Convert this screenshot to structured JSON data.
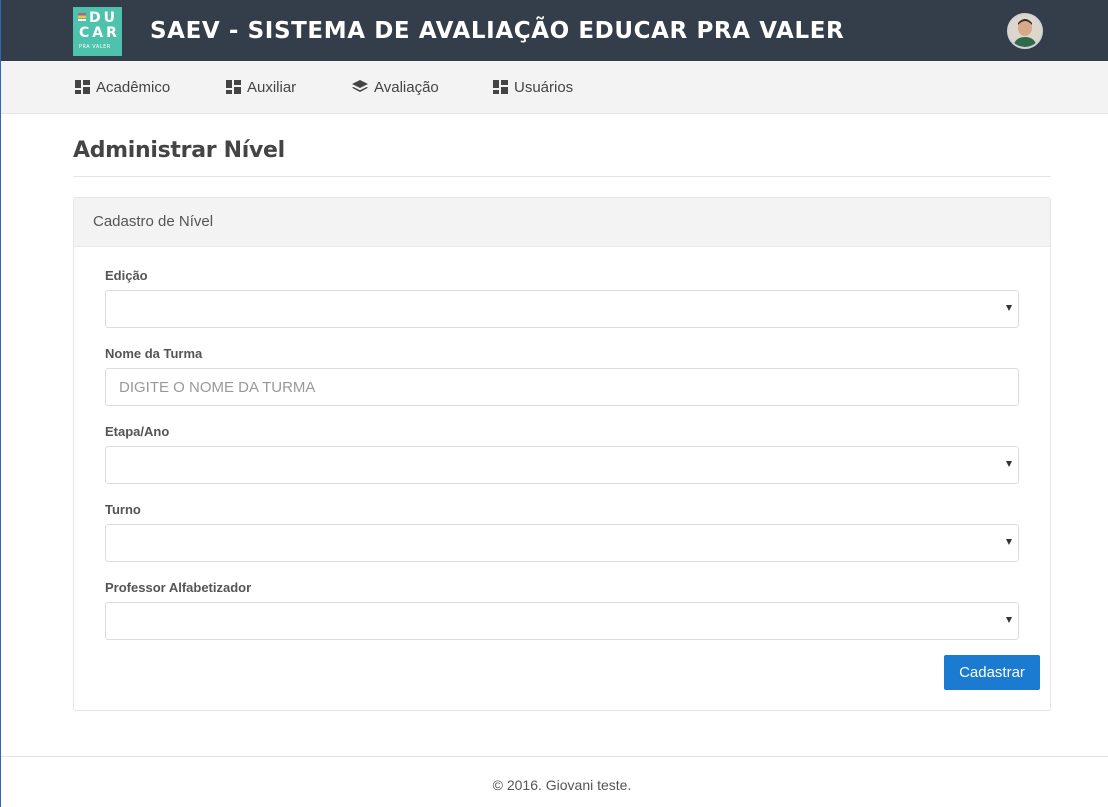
{
  "header": {
    "logo_lines": [
      "DU",
      "CAR",
      "PRA VALER"
    ],
    "title": "SAEV - SISTEMA DE AVALIAÇÃO EDUCAR PRA VALER",
    "colors": {
      "bar_bg": "#343d4a",
      "logo_bg": "#4fc2ad"
    }
  },
  "nav": {
    "items": [
      {
        "label": "Acadêmico",
        "icon": "dashboard-icon"
      },
      {
        "label": "Auxiliar",
        "icon": "dashboard-icon"
      },
      {
        "label": "Avaliação",
        "icon": "layers-icon"
      },
      {
        "label": "Usuários",
        "icon": "dashboard-icon"
      }
    ]
  },
  "page": {
    "title": "Administrar Nível"
  },
  "panel": {
    "title": "Cadastro de Nível",
    "fields": {
      "edicao": {
        "label": "Edição",
        "value": ""
      },
      "turma": {
        "label": "Nome da Turma",
        "placeholder": "DIGITE O NOME DA TURMA",
        "value": ""
      },
      "etapa": {
        "label": "Etapa/Ano",
        "value": ""
      },
      "turno": {
        "label": "Turno",
        "value": ""
      },
      "professor": {
        "label": "Professor Alfabetizador",
        "value": ""
      }
    },
    "submit_label": "Cadastrar",
    "accent_color": "#1a7bd0"
  },
  "footer": {
    "text": "© 2016. Giovani teste."
  }
}
